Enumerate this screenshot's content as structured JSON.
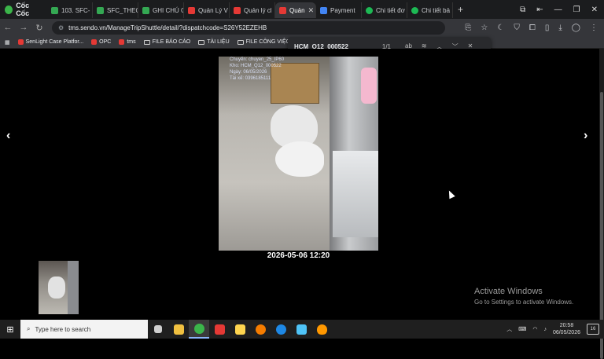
{
  "browser": {
    "brand": "Cốc Cốc",
    "tabs": [
      {
        "label": "103. SFC-",
        "favicon_color": "#34a853"
      },
      {
        "label": "SFC_THEO",
        "favicon_color": "#34a853"
      },
      {
        "label": "GHI CHÚ C",
        "favicon_color": "#34a853"
      },
      {
        "label": "Quản Lý V",
        "favicon_color": "#e53935"
      },
      {
        "label": "Quản lý cl",
        "favicon_color": "#e53935"
      },
      {
        "label": "Quản",
        "favicon_color": "#e53935",
        "active": true
      },
      {
        "label": "Payment",
        "favicon_color": "#4285f4"
      },
      {
        "label": "Chi tiết đơ",
        "favicon_color": "#1db954"
      },
      {
        "label": "Chi tiết bả",
        "favicon_color": "#1db954"
      }
    ],
    "new_tab": "+",
    "url": "tms.sendo.vn/ManageTripShuttle/detail/?dispatchcode=S26Y52EZEHB",
    "bookmarks": [
      "SenLight Case Platfor...",
      "OPC",
      "tms",
      "FILE BÁO CÁO",
      "TÀI LIỆU",
      "FILE CÔNG VIỆC"
    ]
  },
  "find_bar": {
    "query": "HCM_Q12_000522",
    "count": "1/1"
  },
  "viewer": {
    "prev_arrow": "‹",
    "next_arrow": "›",
    "watermark_lines": [
      "Chuyển: chuyen_25_IP60",
      "Kho: HCM_Q12_000522",
      "Ngày: 06/05/2026",
      "Tài xế: 0396185111"
    ],
    "caption": "2026-05-06 12:20"
  },
  "windows_activation": {
    "title": "Activate Windows",
    "subtitle": "Go to Settings to activate Windows."
  },
  "taskbar": {
    "search_placeholder": "Type here to search",
    "time": "20:58",
    "date": "06/05/2026",
    "notification_count": "16",
    "apps": [
      "#cfcfcf",
      "#f0c040",
      "#3bb54a",
      "#e53935",
      "#ffd54f",
      "#f57c00",
      "#1e88e5",
      "#4fc3f7",
      "#ff9800"
    ]
  }
}
